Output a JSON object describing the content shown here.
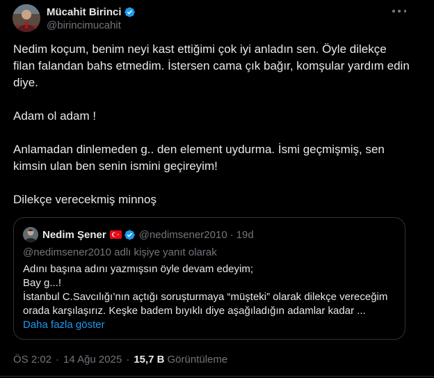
{
  "colors": {
    "background": "#000000",
    "text_primary": "#e7e9ea",
    "text_secondary": "#71767b",
    "link": "#1d9bf0",
    "verified": "#1d9bf0",
    "border": "#2f3336"
  },
  "tweet": {
    "author": {
      "display_name": "Mücahit Birinci",
      "handle": "@birincimucahit",
      "verified_icon": "verified-badge-icon",
      "avatar_icon": "avatar"
    },
    "more_icon": "more-horizontal-icon",
    "paragraphs": [
      "Nedim koçum, benim neyi kast ettiğimi çok iyi anladın sen. Öyle dilekçe filan falandan bahs etmedim. İstersen cama çık bağır, komşular yardım edin diye.",
      "Adam ol adam !",
      "Anlamadan dinlemeden g.. den element uydurma. İsmi geçmişmiş, sen kimsin ulan ben senin ismini geçireyim!",
      "Dilekçe verecekmiş minnoş"
    ],
    "quote": {
      "display_name": "Nedim Şener",
      "flag_icon": "turkey-flag-icon",
      "handle": "@nedimsener2010",
      "separator": "·",
      "time": "19d",
      "reply_context": "@nedimsener2010 adlı kişiye yanıt olarak",
      "lines": [
        "Adını başına adını yazmışsın öyle devam edeyim;",
        "Bay g...!",
        "İstanbul C.Savcılığı’nın açtığı soruşturmaya “müşteki” olarak dilekçe vereceğim orada karşılaşırız. Keşke badem bıyıklı diye aşağıladığın adamlar kadar ..."
      ],
      "show_more": "Daha fazla göster"
    },
    "meta": {
      "time": "ÖS 2:02",
      "dot1": "·",
      "date": "14 Ağu 2025",
      "dot2": "·",
      "views_count": "15,7 B",
      "views_label": "Görüntüleme"
    }
  }
}
